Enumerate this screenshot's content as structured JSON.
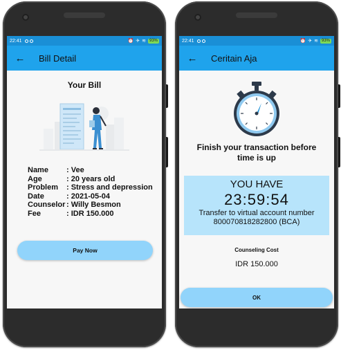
{
  "status": {
    "time": "22:41",
    "icons": [
      "alarm-icon",
      "airplane-mode-icon",
      "wifi-icon",
      "battery-icon"
    ],
    "battery": "93%"
  },
  "bill_screen": {
    "appbar_title": "Bill Detail",
    "heading": "Your Bill",
    "details": [
      {
        "label": "Name",
        "value": ": Vee"
      },
      {
        "label": "Age",
        "value": ": 20 years old"
      },
      {
        "label": "Problem",
        "value": ": Stress and depression"
      },
      {
        "label": "Date",
        "value": ": 2021-05-04"
      },
      {
        "label": "Counselor",
        "value": ": Willy Besmon"
      },
      {
        "label": "Fee",
        "value": ": IDR 150.000"
      }
    ],
    "pay_button": "Pay Now"
  },
  "payment_screen": {
    "appbar_title": "Ceritain Aja",
    "finish_text": "Finish your transaction before time is up",
    "you_have": "YOU HAVE",
    "countdown": "23:59:54",
    "transfer_text": "Transfer to virtual account number 800070818282800 (BCA)",
    "cost_label": "Counseling Cost",
    "cost_value": "IDR 150.000",
    "ok_button": "OK"
  },
  "colors": {
    "status_bar": "#1a8fd6",
    "app_bar": "#1fa3ec",
    "button": "#91d4fb",
    "timer_box": "#b7e4fb",
    "phone_body": "#2c2c2c"
  }
}
